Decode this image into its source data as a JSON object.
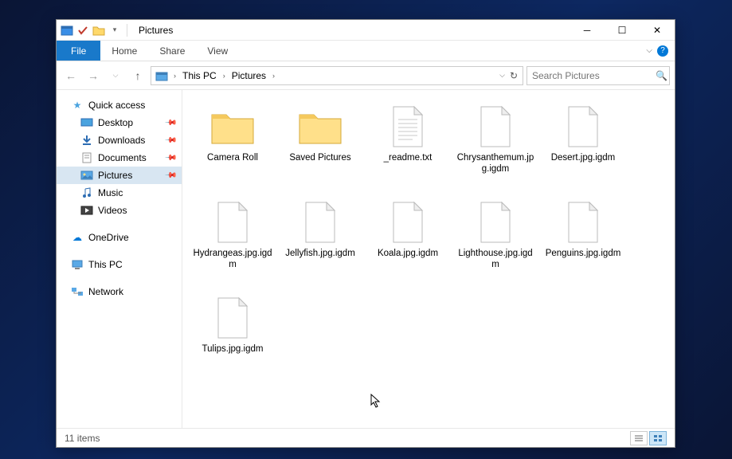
{
  "window": {
    "title": "Pictures"
  },
  "ribbon": {
    "file": "File",
    "tabs": [
      "Home",
      "Share",
      "View"
    ]
  },
  "breadcrumb": {
    "segments": [
      "This PC",
      "Pictures"
    ]
  },
  "search": {
    "placeholder": "Search Pictures"
  },
  "sidebar": {
    "quick_access": {
      "label": "Quick access"
    },
    "quick_items": [
      {
        "label": "Desktop",
        "pinned": true
      },
      {
        "label": "Downloads",
        "pinned": true
      },
      {
        "label": "Documents",
        "pinned": true
      },
      {
        "label": "Pictures",
        "pinned": true,
        "selected": true
      },
      {
        "label": "Music",
        "pinned": false
      },
      {
        "label": "Videos",
        "pinned": false
      }
    ],
    "onedrive": {
      "label": "OneDrive"
    },
    "thispc": {
      "label": "This PC"
    },
    "network": {
      "label": "Network"
    }
  },
  "items": [
    {
      "name": "Camera Roll",
      "type": "folder"
    },
    {
      "name": "Saved Pictures",
      "type": "folder"
    },
    {
      "name": "_readme.txt",
      "type": "txt"
    },
    {
      "name": "Chrysanthemum.jpg.igdm",
      "type": "file"
    },
    {
      "name": "Desert.jpg.igdm",
      "type": "file"
    },
    {
      "name": "Hydrangeas.jpg.igdm",
      "type": "file"
    },
    {
      "name": "Jellyfish.jpg.igdm",
      "type": "file"
    },
    {
      "name": "Koala.jpg.igdm",
      "type": "file"
    },
    {
      "name": "Lighthouse.jpg.igdm",
      "type": "file"
    },
    {
      "name": "Penguins.jpg.igdm",
      "type": "file"
    },
    {
      "name": "Tulips.jpg.igdm",
      "type": "file"
    }
  ],
  "status": {
    "count_label": "11 items"
  }
}
